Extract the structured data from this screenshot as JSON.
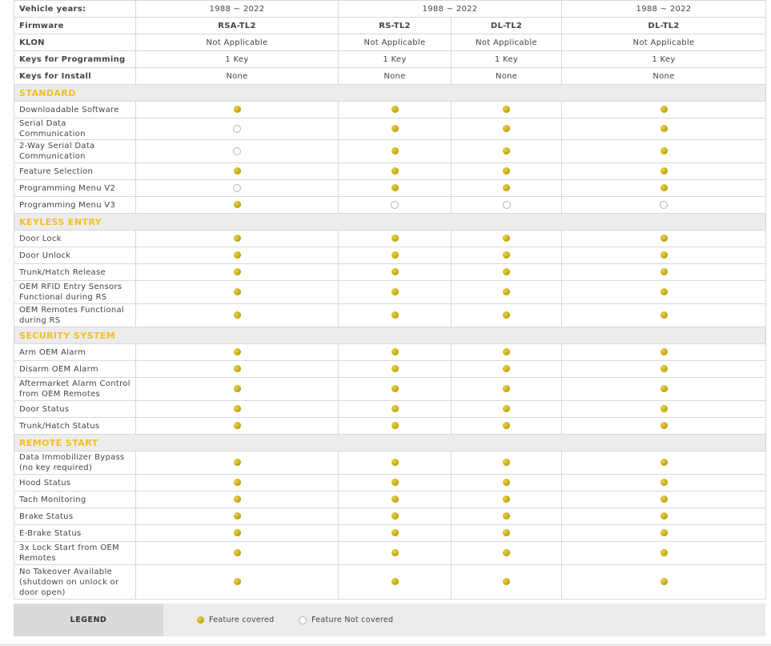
{
  "header": {
    "vehicle_years_label": "Vehicle years:",
    "years": [
      "1988 ~ 2022",
      "1988 ~ 2022",
      "1988 ~ 2022"
    ],
    "firmware_label": "Firmware",
    "models": [
      "RSA-TL2",
      "RS-TL2",
      "DL-TL2",
      "DL-TL2"
    ],
    "klon_label": "KLON",
    "klon": [
      "Not Applicable",
      "Not Applicable",
      "Not Applicable",
      "Not Applicable"
    ],
    "keys_programming_label": "Keys for Programming",
    "keys_programming": [
      "1 Key",
      "1 Key",
      "1 Key",
      "1 Key"
    ],
    "keys_install_label": "Keys for Install",
    "keys_install": [
      "None",
      "None",
      "None",
      "None"
    ]
  },
  "sections": [
    {
      "title": "STANDARD",
      "rows": [
        {
          "feature": "Downloadable Software",
          "cov": [
            1,
            1,
            1,
            1
          ],
          "h": 1
        },
        {
          "feature": "Serial Data Communication",
          "cov": [
            0,
            1,
            1,
            1
          ],
          "h": 1
        },
        {
          "feature": "2-Way Serial Data Communication",
          "cov": [
            0,
            1,
            1,
            1
          ],
          "h": 2
        },
        {
          "feature": "Feature Selection",
          "cov": [
            1,
            1,
            1,
            1
          ],
          "h": 1
        },
        {
          "feature": "Programming Menu V2",
          "cov": [
            0,
            1,
            1,
            1
          ],
          "h": 1
        },
        {
          "feature": "Programming Menu V3",
          "cov": [
            1,
            0,
            0,
            0
          ],
          "h": 1
        }
      ]
    },
    {
      "title": "KEYLESS ENTRY",
      "rows": [
        {
          "feature": "Door Lock",
          "cov": [
            1,
            1,
            1,
            1
          ],
          "h": 1
        },
        {
          "feature": "Door Unlock",
          "cov": [
            1,
            1,
            1,
            1
          ],
          "h": 1
        },
        {
          "feature": "Trunk/Hatch Release",
          "cov": [
            1,
            1,
            1,
            1
          ],
          "h": 1
        },
        {
          "feature": "OEM RFID Entry Sensors Functional during RS",
          "cov": [
            1,
            1,
            1,
            1
          ],
          "h": 2
        },
        {
          "feature": "OEM Remotes Functional during RS",
          "cov": [
            1,
            1,
            1,
            1
          ],
          "h": 2
        }
      ]
    },
    {
      "title": "SECURITY SYSTEM",
      "rows": [
        {
          "feature": "Arm OEM Alarm",
          "cov": [
            1,
            1,
            1,
            1
          ],
          "h": 1
        },
        {
          "feature": "Disarm OEM Alarm",
          "cov": [
            1,
            1,
            1,
            1
          ],
          "h": 1
        },
        {
          "feature": "Aftermarket Alarm Control from OEM Remotes",
          "cov": [
            1,
            1,
            1,
            1
          ],
          "h": 2
        },
        {
          "feature": "Door Status",
          "cov": [
            1,
            1,
            1,
            1
          ],
          "h": 1
        },
        {
          "feature": "Trunk/Hatch Status",
          "cov": [
            1,
            1,
            1,
            1
          ],
          "h": 1
        }
      ]
    },
    {
      "title": "REMOTE START",
      "rows": [
        {
          "feature": "Data Immobilizer Bypass (no key required)",
          "cov": [
            1,
            1,
            1,
            1
          ],
          "h": 2
        },
        {
          "feature": "Hood Status",
          "cov": [
            1,
            1,
            1,
            1
          ],
          "h": 1
        },
        {
          "feature": "Tach Monitoring",
          "cov": [
            1,
            1,
            1,
            1
          ],
          "h": 1
        },
        {
          "feature": "Brake Status",
          "cov": [
            1,
            1,
            1,
            1
          ],
          "h": 1
        },
        {
          "feature": "E-Brake Status",
          "cov": [
            1,
            1,
            1,
            1
          ],
          "h": 1
        },
        {
          "feature": "3x Lock Start from OEM Remotes",
          "cov": [
            1,
            1,
            1,
            1
          ],
          "h": 2
        },
        {
          "feature": "No Takeover Available (shutdown on unlock or door open)",
          "cov": [
            1,
            1,
            1,
            1
          ],
          "h": 3
        }
      ]
    }
  ],
  "legend": {
    "title": "LEGEND",
    "covered_label": "Feature covered",
    "not_covered_label": "Feature Not covered"
  },
  "colors": {
    "section_title": "#f0c020",
    "dot_covered": "#c9ac12",
    "section_bg": "#ececec"
  }
}
